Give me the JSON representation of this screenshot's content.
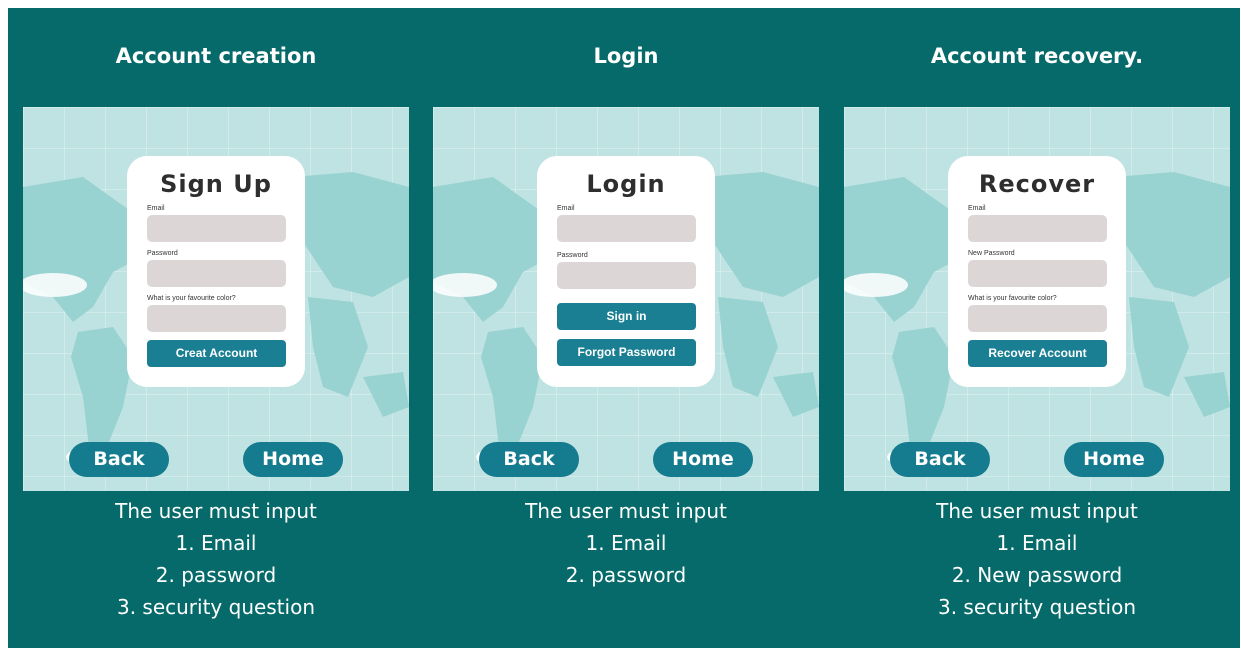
{
  "panels": [
    {
      "title": "Account creation",
      "card_title": "Sign Up",
      "fields": [
        "Email",
        "Password",
        "What is your favourite color?"
      ],
      "buttons": [
        "Creat Account"
      ],
      "nav": {
        "back": "Back",
        "home": "Home"
      },
      "caption": [
        "The user must input",
        "1. Email",
        "2. password",
        "3. security question"
      ]
    },
    {
      "title": "Login",
      "card_title": "Login",
      "fields": [
        "Email",
        "Password"
      ],
      "buttons": [
        "Sign in",
        "Forgot Password"
      ],
      "nav": {
        "back": "Back",
        "home": "Home"
      },
      "caption": [
        "The user must input",
        "1. Email",
        "2. password"
      ]
    },
    {
      "title": "Account recovery.",
      "card_title": "Recover",
      "fields": [
        "Email",
        "New Password",
        "What is your favourite color?"
      ],
      "buttons": [
        "Recover Account"
      ],
      "nav": {
        "back": "Back",
        "home": "Home"
      },
      "caption": [
        "The user must input",
        "1. Email",
        "2. New password",
        "3. security question"
      ]
    }
  ],
  "colors": {
    "slide_bg": "#066a6a",
    "button": "#1a7f92",
    "nav_button": "#157b8e",
    "input": "#ddd6d6",
    "screen_bg": "#bfe3e2"
  }
}
